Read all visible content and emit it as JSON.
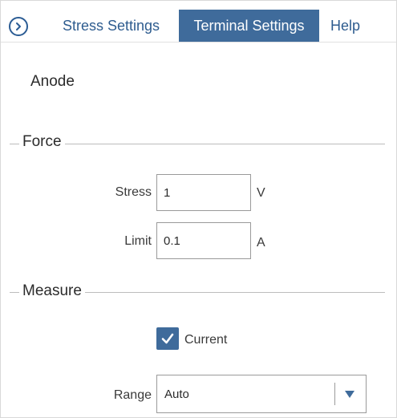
{
  "tabs": {
    "nav_icon": "chevron-right-circle-icon",
    "items": [
      {
        "label": "Stress Settings",
        "active": false
      },
      {
        "label": "Terminal Settings",
        "active": true
      },
      {
        "label": "Help",
        "active": false
      }
    ]
  },
  "terminal": {
    "name": "Anode"
  },
  "force": {
    "title": "Force",
    "stress": {
      "label": "Stress",
      "value": "1",
      "unit": "V"
    },
    "limit": {
      "label": "Limit",
      "value": "0.1",
      "unit": "A"
    }
  },
  "measure": {
    "title": "Measure",
    "current": {
      "label": "Current",
      "checked": true
    },
    "range": {
      "label": "Range",
      "value": "Auto",
      "icon": "dropdown-arrow-icon"
    }
  },
  "colors": {
    "accent": "#3f6b9b",
    "tab_text": "#2e5c8f"
  }
}
